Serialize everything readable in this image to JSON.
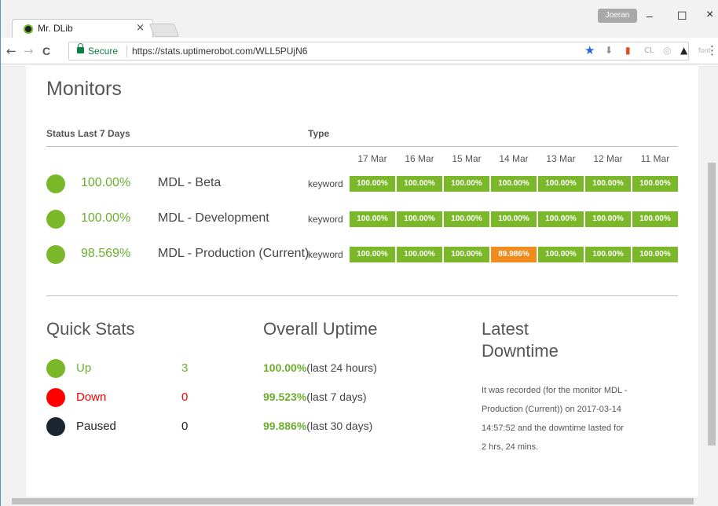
{
  "browser": {
    "tab_title": "Mr. DLib",
    "tab_close": "×",
    "user_label": "Joeran",
    "win_min": "–",
    "win_max": "☐",
    "win_close": "×",
    "back": "←",
    "forward": "→",
    "reload": "C",
    "secure_label": "Secure",
    "url": "https://stats.uptimerobot.com/WLL5PUjN6",
    "bookmark_star": "★",
    "menu": "⋮"
  },
  "monitors": {
    "title": "Monitors",
    "col_status": "Status Last 7 Days",
    "col_type": "Type",
    "dates": [
      "17 Mar",
      "16 Mar",
      "15 Mar",
      "14 Mar",
      "13 Mar",
      "12 Mar",
      "11 Mar"
    ],
    "rows": [
      {
        "uptime": "100.00%",
        "name": "MDL - Beta",
        "type": "keyword",
        "days": [
          "100.00%",
          "100.00%",
          "100.00%",
          "100.00%",
          "100.00%",
          "100.00%",
          "100.00%"
        ]
      },
      {
        "uptime": "100.00%",
        "name": "MDL - Development",
        "type": "keyword",
        "days": [
          "100.00%",
          "100.00%",
          "100.00%",
          "100.00%",
          "100.00%",
          "100.00%",
          "100.00%"
        ]
      },
      {
        "uptime": "98.569%",
        "name": "MDL - Production (Current)",
        "type": "keyword",
        "days": [
          "100.00%",
          "100.00%",
          "100.00%",
          "89.986%",
          "100.00%",
          "100.00%",
          "100.00%"
        ]
      }
    ]
  },
  "colors": {
    "up": "#7ab829",
    "warn": "#f18b1e",
    "down": "#ff0000",
    "paused": "#1b2631"
  },
  "quick_stats": {
    "title": "Quick Stats",
    "items": [
      {
        "label": "Up",
        "value": "3"
      },
      {
        "label": "Down",
        "value": "0"
      },
      {
        "label": "Paused",
        "value": "0"
      }
    ]
  },
  "overall_uptime": {
    "title": "Overall Uptime",
    "items": [
      {
        "value": "100.00%",
        "period": "(last 24 hours)"
      },
      {
        "value": "99.523%",
        "period": "(last 7 days)"
      },
      {
        "value": "99.886%",
        "period": "(last 30 days)"
      }
    ]
  },
  "latest_downtime": {
    "title_line1": "Latest",
    "title_line2": "Downtime",
    "text": "It was recorded (for the monitor MDL - Production (Current)) on 2017-03-14 14:57:52 and the downtime lasted for 2 hrs, 24 mins."
  }
}
